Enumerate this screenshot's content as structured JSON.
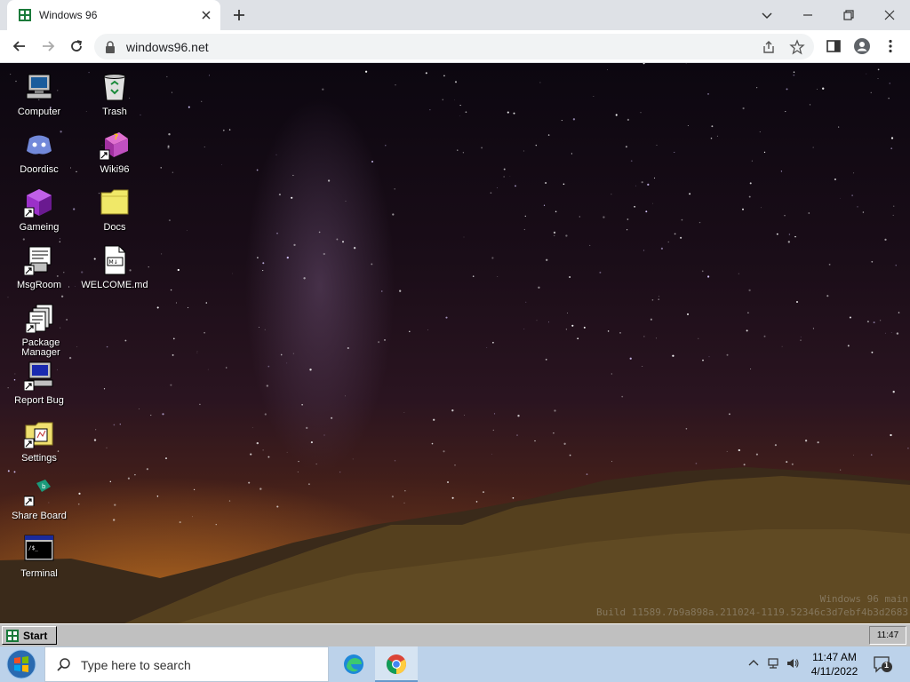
{
  "browser": {
    "tab_title": "Windows 96",
    "url": "windows96.net"
  },
  "desktop": {
    "icons": [
      {
        "label": "Computer"
      },
      {
        "label": "Doordisc"
      },
      {
        "label": "Gameing"
      },
      {
        "label": "MsgRoom"
      },
      {
        "label": "Package Manager"
      },
      {
        "label": "Report Bug"
      },
      {
        "label": "Settings"
      },
      {
        "label": "Share Board"
      },
      {
        "label": "Terminal"
      },
      {
        "label": "Trash"
      },
      {
        "label": "Wiki96"
      },
      {
        "label": "Docs"
      },
      {
        "label": "WELCOME.md"
      }
    ],
    "build_line1": "Windows 96 main",
    "build_line2": "Build 11589.7b9a898a.211024-1119.52346c3d7ebf4b3d2683"
  },
  "w96_taskbar": {
    "start_label": "Start",
    "clock": "11:47"
  },
  "os_taskbar": {
    "search_placeholder": "Type here to search",
    "time": "11:47 AM",
    "date": "4/11/2022",
    "notification_count": "1"
  },
  "colors": {
    "w96_gray": "#c0c0c0",
    "taskbar_blue": "#bcd2ea",
    "chrome_tab_strip": "#dee1e6"
  }
}
